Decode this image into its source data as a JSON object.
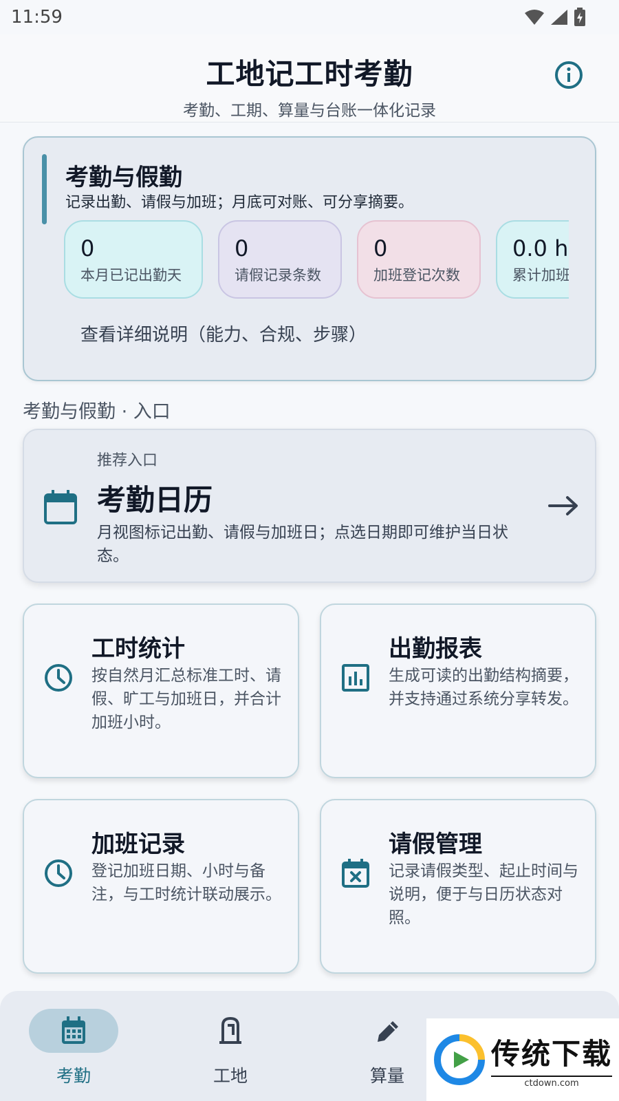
{
  "status_bar": {
    "time": "11:59"
  },
  "header": {
    "title": "工地记工时考勤",
    "subtitle": "考勤、工期、算量与台账一体化记录"
  },
  "summary": {
    "title": "考勤与假勤",
    "description": "记录出勤、请假与加班；月底可对账、可分享摘要。",
    "stats": [
      {
        "value": "0",
        "label": "本月已记出勤天",
        "bg": "#d9f3f5",
        "border": "#a9dde3"
      },
      {
        "value": "0",
        "label": "请假记录条数",
        "bg": "#e5e3f2",
        "border": "#c9c5e3"
      },
      {
        "value": "0",
        "label": "加班登记次数",
        "bg": "#f2dfe7",
        "border": "#e6c2d1"
      },
      {
        "value": "0.0 h",
        "label": "累计加班",
        "bg": "#d9f3f5",
        "border": "#a9dde3"
      }
    ],
    "detail_link": "查看详细说明（能力、合规、步骤）"
  },
  "section": {
    "label": "考勤与假勤 · 入口"
  },
  "hero": {
    "eyebrow": "推荐入口",
    "title": "考勤日历",
    "description": "月视图标记出勤、请假与加班日；点选日期即可维护当日状态。",
    "icon": "calendar-icon"
  },
  "features": [
    {
      "title": "工时统计",
      "description": "按自然月汇总标准工时、请假、旷工与加班日，并合计加班小时。",
      "icon": "clock-icon"
    },
    {
      "title": "出勤报表",
      "description": "生成可读的出勤结构摘要，并支持通过系统分享转发。",
      "icon": "bar-chart-icon"
    },
    {
      "title": "加班记录",
      "description": "登记加班日期、小时与备注，与工时统计联动展示。",
      "icon": "clock-icon"
    },
    {
      "title": "请假管理",
      "description": "记录请假类型、起止时间与说明，便于与日历状态对照。",
      "icon": "calendar-x-icon"
    }
  ],
  "bottom_nav": [
    {
      "label": "考勤",
      "icon": "calendar-icon",
      "active": true
    },
    {
      "label": "工地",
      "icon": "helmet-icon",
      "active": false
    },
    {
      "label": "算量",
      "icon": "pencil-icon",
      "active": false
    }
  ],
  "watermark": {
    "title": "传统下载",
    "url": "ctdown.com"
  },
  "colors": {
    "accent": "#1f6f84",
    "active_nav": "#1f6f84",
    "text_primary": "#111827"
  }
}
